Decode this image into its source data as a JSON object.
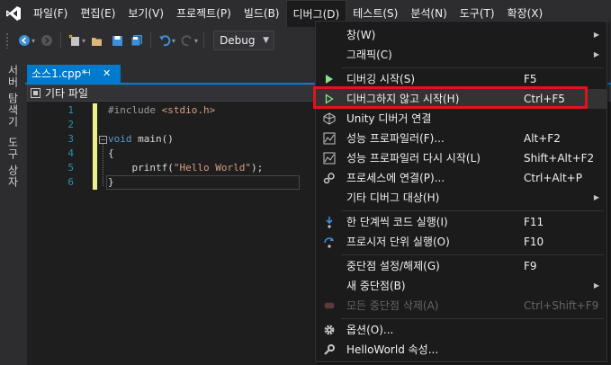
{
  "menubar": {
    "logo": "visual-studio-logo",
    "items": [
      "파일(F)",
      "편집(E)",
      "보기(V)",
      "프로젝트(P)",
      "빌드(B)",
      "디버그(D)",
      "테스트(S)",
      "분석(N)",
      "도구(T)",
      "확장(X)"
    ],
    "active_index": 5
  },
  "toolbar": {
    "configuration": "Debug",
    "icons": [
      "back-icon",
      "forward-icon",
      "new-project-icon",
      "open-icon",
      "save-icon",
      "save-all-icon",
      "undo-icon",
      "redo-icon"
    ]
  },
  "left_strip": {
    "tab1": "서버 탐색기",
    "tab2": "도구 상자"
  },
  "document_tab": {
    "title": "소스1.cpp*",
    "pin": "⊣",
    "close": "✕"
  },
  "navbar": {
    "scope": "기타 파일"
  },
  "editor": {
    "line_numbers": [
      "1",
      "2",
      "3",
      "4",
      "5",
      "6"
    ]
  },
  "debug_menu": {
    "items": [
      {
        "label": "창(W)",
        "shortcut": "",
        "icon": "",
        "submenu": true
      },
      {
        "label": "그래픽(C)",
        "shortcut": "",
        "icon": "",
        "submenu": true
      },
      {
        "label": "디버깅 시작(S)",
        "shortcut": "F5",
        "icon": "start-debugging-icon",
        "submenu": false
      },
      {
        "label": "디버그하지 않고 시작(H)",
        "shortcut": "Ctrl+F5",
        "icon": "start-without-debugging-icon",
        "submenu": false
      },
      {
        "label": "Unity 디버거 연결",
        "shortcut": "",
        "icon": "unity-icon",
        "submenu": false
      },
      {
        "label": "성능 프로파일러(F)...",
        "shortcut": "Alt+F2",
        "icon": "performance-profiler-icon",
        "submenu": false
      },
      {
        "label": "성능 프로파일러 다시 시작(L)",
        "shortcut": "Shift+Alt+F2",
        "icon": "relaunch-profiler-icon",
        "submenu": false
      },
      {
        "label": "프로세스에 연결(P)...",
        "shortcut": "Ctrl+Alt+P",
        "icon": "attach-process-icon",
        "submenu": false
      },
      {
        "label": "기타 디버그 대상(H)",
        "shortcut": "",
        "icon": "",
        "submenu": true
      },
      {
        "label": "한 단계씩 코드 실행(I)",
        "shortcut": "F11",
        "icon": "step-into-icon",
        "submenu": false
      },
      {
        "label": "프로시저 단위 실행(O)",
        "shortcut": "F10",
        "icon": "step-over-icon",
        "submenu": false
      },
      {
        "label": "중단점 설정/해제(G)",
        "shortcut": "F9",
        "icon": "",
        "submenu": false
      },
      {
        "label": "새 중단점(B)",
        "shortcut": "",
        "icon": "",
        "submenu": true
      },
      {
        "label": "모든 중단점 삭제(A)",
        "shortcut": "Ctrl+Shift+F9",
        "icon": "delete-breakpoints-icon",
        "submenu": false,
        "disabled": true
      },
      {
        "label": "옵션(O)...",
        "shortcut": "",
        "icon": "gear-icon",
        "submenu": false
      },
      {
        "label": "HelloWorld 속성...",
        "shortcut": "",
        "icon": "wrench-icon",
        "submenu": false
      }
    ]
  },
  "colors": {
    "accent": "#007acc",
    "highlight_box": "#e0141e",
    "start_green": "#8ae28a"
  }
}
